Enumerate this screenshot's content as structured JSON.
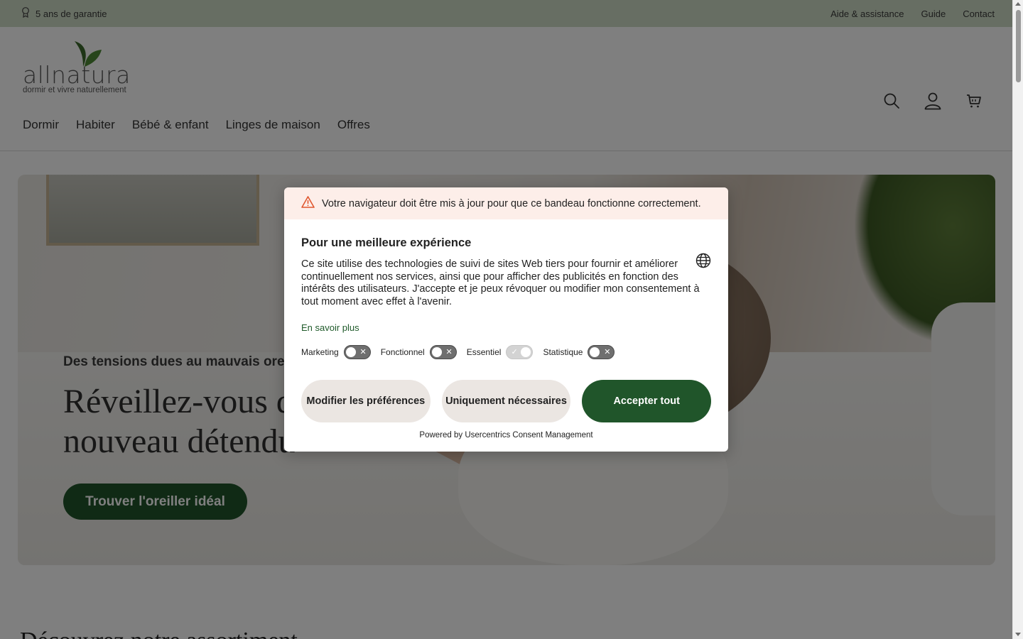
{
  "topbar": {
    "guarantee": "5 ans de garantie",
    "links": [
      "Aide & assistance",
      "Guide",
      "Contact"
    ]
  },
  "logo": {
    "word": "allnatura",
    "tagline": "dormir et vivre naturellement"
  },
  "header_icons": [
    "search-icon",
    "account-icon",
    "cart-icon"
  ],
  "nav": [
    "Dormir",
    "Habiter",
    "Bébé & enfant",
    "Linges de maison",
    "Offres"
  ],
  "hero": {
    "subtitle": "Des tensions dues au mauvais oreiller ?",
    "title_line1": "Réveillez-vous de",
    "title_line2": "nouveau détendu",
    "cta": "Trouver l'oreiller idéal"
  },
  "below": {
    "title": "Découvrez notre assortiment"
  },
  "consent": {
    "warning": "Votre navigateur doit être mis à jour pour que ce bandeau fonctionne correctement.",
    "title": "Pour une meilleure expérience",
    "text": "Ce site utilise des technologies de suivi de sites Web tiers pour fournir et améliorer continuellement nos services, ainsi que pour afficher des publicités en fonction des intérêts des utilisateurs. J'accepte et je peux révoquer ou modifier mon consentement à tout moment avec effet à l'avenir.",
    "learn_more": "En savoir plus",
    "toggles": [
      {
        "label": "Marketing",
        "state": "off"
      },
      {
        "label": "Fonctionnel",
        "state": "off"
      },
      {
        "label": "Essentiel",
        "state": "on-disabled"
      },
      {
        "label": "Statistique",
        "state": "off"
      }
    ],
    "buttons": {
      "preferences": "Modifier les préférences",
      "necessary": "Uniquement nécessaires",
      "accept": "Accepter tout"
    },
    "powered": "Powered by Usercentrics Consent Management"
  },
  "colors": {
    "brand_green": "#20552a",
    "topbar": "#cfdcc6",
    "warning_bg": "#fdeee9",
    "warning_icon": "#e0572f"
  }
}
